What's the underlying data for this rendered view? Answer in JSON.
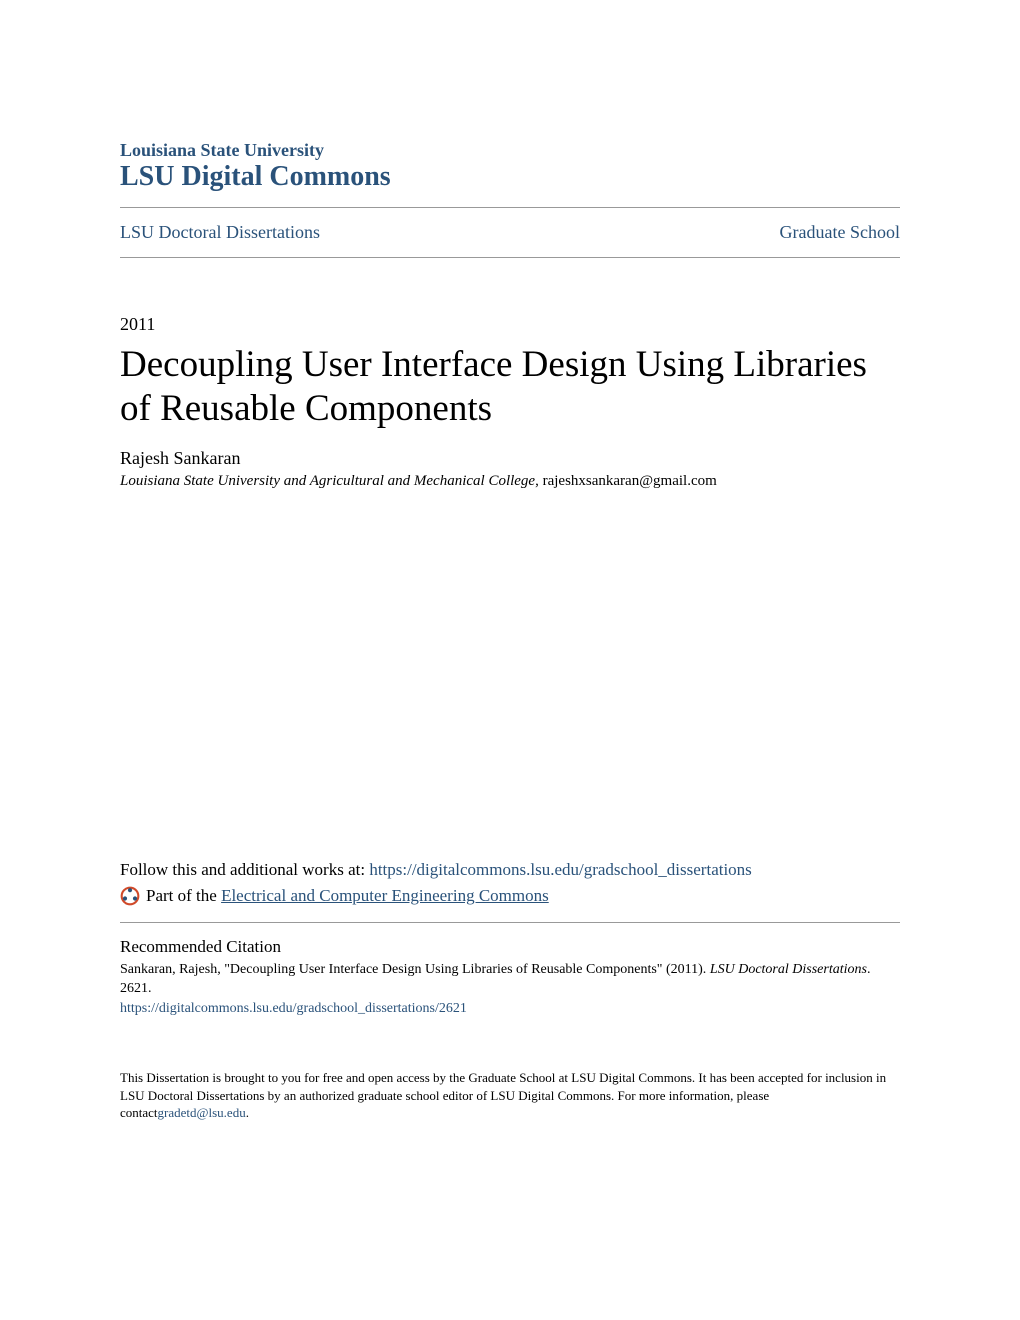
{
  "header": {
    "institution": "Louisiana State University",
    "repository": "LSU Digital Commons"
  },
  "breadcrumb": {
    "collection": "LSU Doctoral Dissertations",
    "school": "Graduate School"
  },
  "paper": {
    "year": "2011",
    "title": "Decoupling User Interface Design Using Libraries of Reusable Components",
    "author": "Rajesh Sankaran",
    "affiliation": "Louisiana State University and Agricultural and Mechanical College",
    "email": "rajeshxsankaran@gmail.com"
  },
  "follow": {
    "prefix": "Follow this and additional works at: ",
    "url": "https://digitalcommons.lsu.edu/gradschool_dissertations",
    "partof_prefix": "Part of the ",
    "partof_link": "Electrical and Computer Engineering Commons"
  },
  "citation": {
    "heading": "Recommended Citation",
    "text_prefix": "Sankaran, Rajesh, \"Decoupling User Interface Design Using Libraries of Reusable Components\" (2011). ",
    "journal": "LSU Doctoral Dissertations",
    "text_suffix": ". 2621.",
    "url": "https://digitalcommons.lsu.edu/gradschool_dissertations/2621"
  },
  "footer": {
    "text_prefix": "This Dissertation is brought to you for free and open access by the Graduate School at LSU Digital Commons. It has been accepted for inclusion in LSU Doctoral Dissertations by an authorized graduate school editor of LSU Digital Commons. For more information, please contact",
    "email": "gradetd@lsu.edu",
    "text_suffix": "."
  }
}
